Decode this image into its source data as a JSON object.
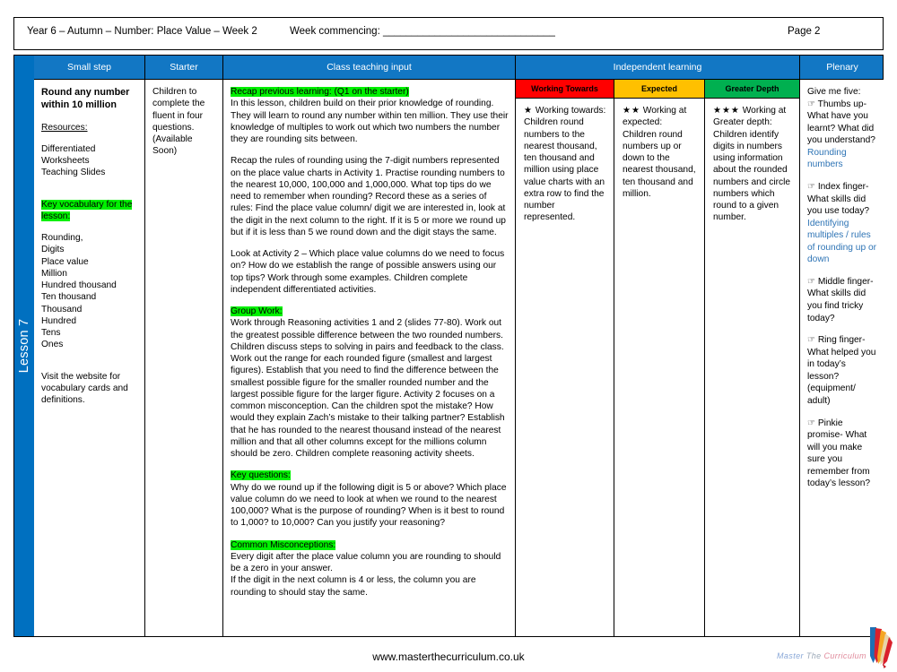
{
  "header": {
    "left_title": "Year 6 – Autumn – Number: Place Value – Week 2",
    "week_commencing": "Week commencing: ______________________________",
    "page_number": "Page 2"
  },
  "lesson_spine": {
    "label": "Lesson 7",
    "color": "#0070C0"
  },
  "columns": [
    {
      "id": "small-step",
      "label": "Small step"
    },
    {
      "id": "starter",
      "label": "Starter"
    },
    {
      "id": "class-teaching-input",
      "label": "Class teaching input"
    },
    {
      "id": "independent-learning",
      "label": "Independent learning"
    },
    {
      "id": "plenary",
      "label": "Plenary"
    }
  ],
  "small_step": {
    "title": "Round any number within 10 million",
    "resources_label": "Resources:",
    "resources": [
      "Differentiated",
      "Worksheets",
      "Teaching Slides"
    ],
    "vocab_heading": "Key vocabulary for the lesson:",
    "vocab": [
      "Rounding,",
      "Digits",
      "Place value",
      "Million",
      "Hundred thousand",
      "Ten thousand",
      "Thousand",
      "Hundred",
      "Tens",
      "Ones"
    ],
    "footer_note": "Visit the website for vocabulary cards and definitions."
  },
  "starter": {
    "text": "Children to complete the fluent in four questions. (Available Soon)"
  },
  "class_teaching_input": {
    "recap_heading": "Recap previous learning: (Q1 on the starter)",
    "recap_body": "In this lesson, children build on their prior knowledge of rounding. They will learn to round any number within ten million. They use their knowledge of multiples to work out which two numbers the number they are rounding sits between.",
    "rules_para": "Recap the rules of rounding using the 7-digit numbers represented on the place value charts in Activity 1. Practise rounding numbers to the nearest  10,000, 100,000 and 1,000,000. What top tips  do we need to remember when rounding?  Record these as a series of rules:  Find the place value column/ digit we are interested in, look at the digit in the next column to the right. If it is 5 or more we round up but if it is less than 5 we round down and the digit stays the same.",
    "activity2_para": "Look at Activity 2 – Which place value columns do we need to focus on?  How do we establish the range of possible answers  using our top tips?  Work through some examples. Children complete independent differentiated activities.",
    "group_work_heading": "Group Work:",
    "group_work_body": "Work through Reasoning activities 1 and 2 (slides 77-80). Work out the greatest possible  difference between the two rounded numbers. Children discuss steps to solving  in pairs and feedback to the class.  Work out the range for each rounded figure (smallest and largest figures). Establish that you need to find the difference between the smallest possible figure for the smaller rounded number and the largest possible figure for the larger figure. Activity 2 focuses on a common misconception. Can the children spot the mistake? How would they explain  Zach’s mistake to their talking partner? Establish that he has rounded to the nearest thousand instead of the nearest million and that all other columns except for the millions column should be zero. Children complete reasoning activity sheets.",
    "key_questions_heading": "Key questions:",
    "key_questions_body": "Why do we round up if the following digit is 5 or above? Which place value column do we need to look at when we round to the nearest 100,000? What is the purpose of rounding? When is it best to round to 1,000? to 10,000? Can you justify your reasoning?",
    "misconceptions_heading": "Common Misconceptions:",
    "misconceptions_line1": "Every digit after the place value column you are rounding to should be a zero in your answer.",
    "misconceptions_line2": "If the digit in the next column is 4 or less, the column you are rounding to should stay the same."
  },
  "independent_learning": {
    "bands": [
      {
        "label": "Working Towards",
        "color": "#FF0000",
        "text_color": "#000000",
        "stars": "★",
        "lead": "Working towards:",
        "body": "Children round numbers to the nearest thousand, ten thousand and million using place value charts with an extra row to find the number represented."
      },
      {
        "label": "Expected",
        "color": "#FFC000",
        "text_color": "#000000",
        "stars": "★★",
        "lead": "Working at expected:",
        "body": "Children round numbers up or down to the nearest thousand, ten thousand and million."
      },
      {
        "label": "Greater Depth",
        "color": "#00B050",
        "text_color": "#000000",
        "stars": "★★★",
        "lead": "Working at Greater depth:",
        "body": "Children identify digits in numbers using information about the rounded numbers and circle numbers which round to a given number."
      }
    ]
  },
  "plenary": {
    "intro": "Give me five:",
    "items": [
      {
        "icon": "hand-icon",
        "prompt": "Thumbs up- What have you learnt? What did you understand?",
        "answer": "Rounding numbers"
      },
      {
        "icon": "hand-icon",
        "prompt": "Index finger- What skills did you use today?",
        "answer": "Identifying multiples / rules of rounding up or down"
      },
      {
        "icon": "hand-icon",
        "prompt": "Middle finger- What skills did you find tricky today?",
        "answer": ""
      },
      {
        "icon": "hand-icon",
        "prompt": "Ring finger- What helped you in today’s lesson? (equipment/ adult)",
        "answer": ""
      },
      {
        "icon": "hand-icon",
        "prompt": "Pinkie promise- What will you make sure you remember from today’s lesson?",
        "answer": ""
      }
    ],
    "answer_color": "#2E74B5"
  },
  "footer": {
    "url": "www.masterthecurriculum.co.uk",
    "logo_word1": "Master",
    "logo_word2": "The",
    "logo_word3": "Curriculum"
  }
}
